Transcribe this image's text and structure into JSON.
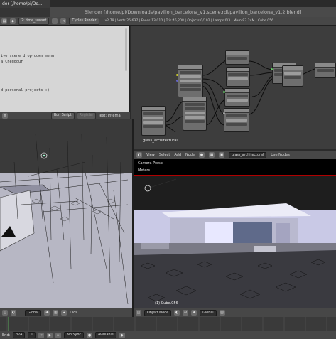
{
  "os": {
    "tab_title": "der [/home/pi/Do...",
    "window_title": "Blender [/home/pi/Downloads/pavilion_barcelona_v1.scene.rdl/pavilion_barcelona_v1.2.blend]"
  },
  "info_header": {
    "scene": "2: time_sunset",
    "engine": "Cycles Render",
    "stats": "v2.79 | Verts:25,637 | Faces:13,010 | Tris:46,208 | Objects:0/102 | Lamps:0/3 | Mem:97.24M | Cube.056"
  },
  "text_editor": {
    "lines": [
      "ive scene drop-down menu",
      "a Chegdour",
      "d personal projects :)"
    ],
    "footer": {
      "run_script": "Run Script",
      "register": "Register",
      "text_internal": "Text: Internal"
    }
  },
  "node_editor": {
    "material_name": "glass_architectural"
  },
  "right_viewport": {
    "header": {
      "view": "View",
      "select": "Select",
      "add": "Add",
      "node": "Node",
      "material_field": "glass_architectural",
      "use_nodes": "Use Nodes"
    },
    "camera_label": "Camera Persp",
    "units_label": "Meters",
    "object_label": "(1) Cube.056",
    "bottom_header": {
      "mode": "Object Mode",
      "pivot": "Global"
    }
  },
  "left_viewport": {
    "bottom_header": {
      "pivot": "Global",
      "close": "Clos"
    }
  },
  "timeline": {
    "end_label": "End:",
    "end_value": "374",
    "frame_value": "1",
    "keying": "No Sync",
    "keyset": "Available"
  },
  "colors": {
    "panel": "#474747",
    "text_editor_bg": "#d6d6d6",
    "node_bg": "#3d3d3d",
    "render_bg": "#000000",
    "highlight": "#d9d9ff"
  }
}
